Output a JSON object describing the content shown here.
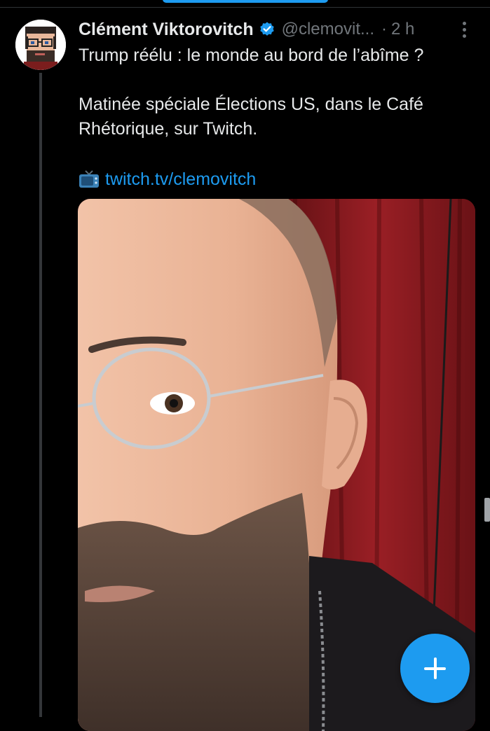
{
  "tweet": {
    "author_name": "Clément Viktorovitch",
    "handle": "@clemovit...",
    "separator": "·",
    "time": "2 h",
    "lines": [
      "Trump réélu : le monde au bord de l’abîme ?",
      "Matinée spéciale Élections US, dans le Café",
      "Rhétorique, sur Twitch."
    ],
    "link_text": "twitch.tv/clemovitch",
    "verified": true,
    "icons": {
      "verified": "verified-badge-icon",
      "more": "more-vertical-icon",
      "link_prefix": "television-emoji-icon"
    }
  },
  "compose": {
    "icon": "plus-icon"
  },
  "colors": {
    "background": "#000000",
    "text": "#e7e9ea",
    "secondary_text": "#71767b",
    "accent": "#1d9bf0",
    "divider": "#2f3336"
  }
}
